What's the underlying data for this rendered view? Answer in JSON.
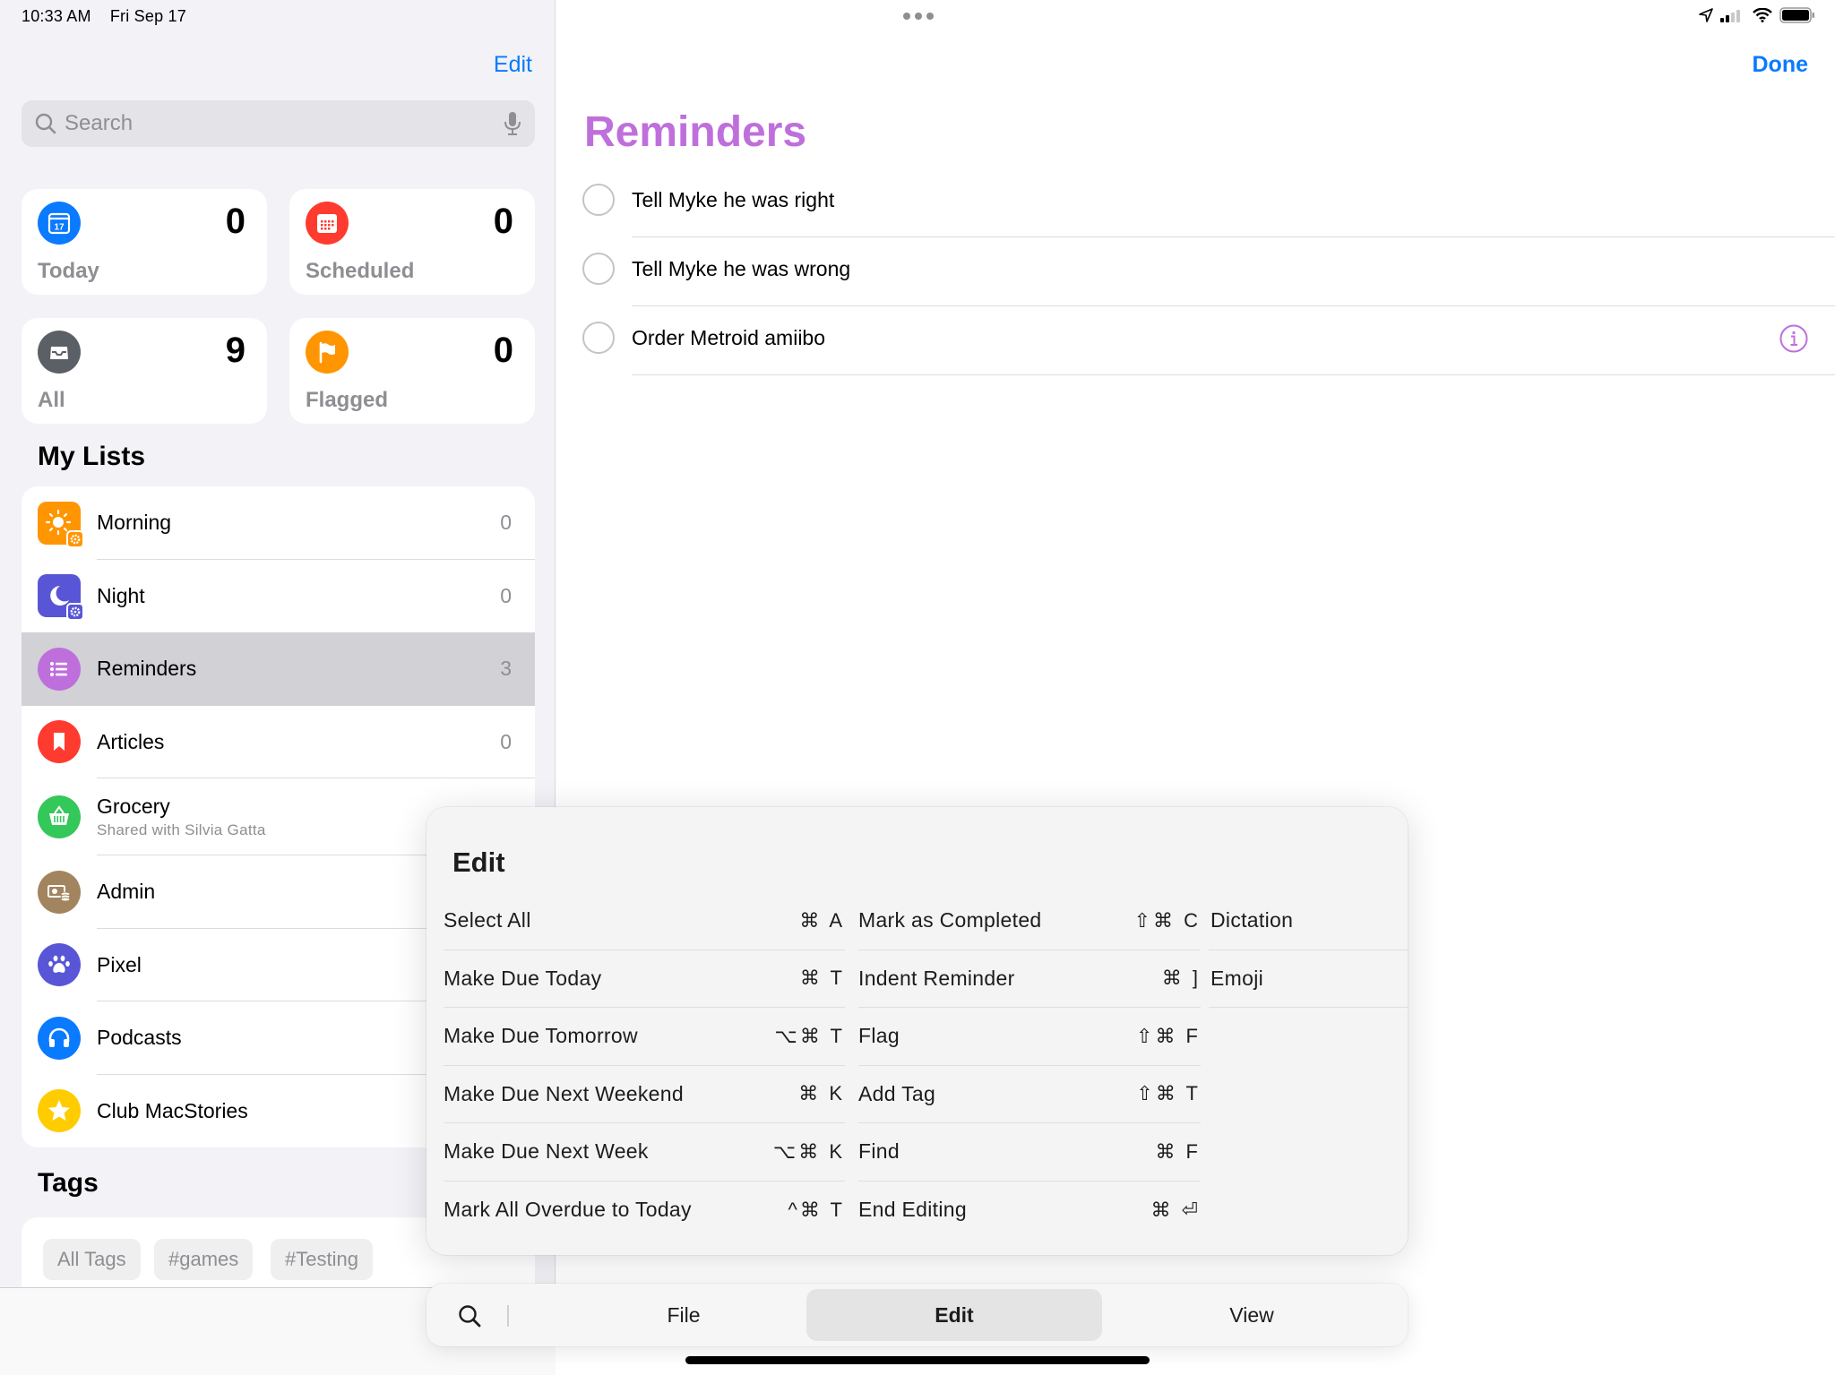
{
  "status_bar": {
    "time": "10:33 AM",
    "date": "Fri Sep 17",
    "icons": [
      "location-arrow-icon",
      "cellular-signal-icon",
      "wifi-icon",
      "battery-icon"
    ]
  },
  "sidebar": {
    "edit_label": "Edit",
    "search": {
      "placeholder": "Search",
      "value": ""
    },
    "smart_lists": [
      {
        "label": "Today",
        "count": "0",
        "icon": "calendar-17-icon",
        "color": "#0a7aff",
        "glyph": "17"
      },
      {
        "label": "Scheduled",
        "count": "0",
        "icon": "calendar-grid-icon",
        "color": "#ff3b30"
      },
      {
        "label": "All",
        "count": "9",
        "icon": "tray-icon",
        "color": "#5b5f66"
      },
      {
        "label": "Flagged",
        "count": "0",
        "icon": "flag-icon",
        "color": "#ff9500"
      }
    ],
    "my_lists_heading": "My Lists",
    "lists": [
      {
        "name": "Morning",
        "count": "0",
        "icon": "sun-icon",
        "color": "#ff9500",
        "shape": "square",
        "badge": "gear"
      },
      {
        "name": "Night",
        "count": "0",
        "icon": "moon-icon",
        "color": "#5856d6",
        "shape": "square",
        "badge": "gear"
      },
      {
        "name": "Reminders",
        "count": "3",
        "icon": "list-bullet-icon",
        "color": "#bf6fdc",
        "shape": "round",
        "selected": true
      },
      {
        "name": "Articles",
        "count": "0",
        "icon": "bookmark-icon",
        "color": "#ff3b30",
        "shape": "round"
      },
      {
        "name": "Grocery",
        "subtitle": "Shared with Silvia Gatta",
        "count": "",
        "icon": "basket-icon",
        "color": "#34c759",
        "shape": "round"
      },
      {
        "name": "Admin",
        "count": "",
        "icon": "money-icon",
        "color": "#a2845e",
        "shape": "round"
      },
      {
        "name": "Pixel",
        "count": "",
        "icon": "paw-icon",
        "color": "#5856d6",
        "shape": "round"
      },
      {
        "name": "Podcasts",
        "count": "",
        "icon": "headphones-icon",
        "color": "#0a7aff",
        "shape": "round"
      },
      {
        "name": "Club MacStories",
        "count": "",
        "icon": "star-icon",
        "color": "#ffcc00",
        "shape": "round"
      }
    ],
    "tags_heading": "Tags",
    "tags": [
      "All Tags",
      "#games",
      "#Testing"
    ]
  },
  "main": {
    "done_label": "Done",
    "title": "Reminders",
    "title_color": "#bf6fdc",
    "reminders": [
      {
        "text": "Tell Myke he was right",
        "completed": false
      },
      {
        "text": "Tell Myke he was wrong",
        "completed": false
      },
      {
        "text": "Order Metroid amiibo",
        "completed": false,
        "show_info": true
      }
    ]
  },
  "edit_menu": {
    "title": "Edit",
    "columns": [
      [
        {
          "label": "Select All",
          "shortcut": "⌘ A"
        },
        {
          "label": "Make Due Today",
          "shortcut": "⌘ T"
        },
        {
          "label": "Make Due Tomorrow",
          "shortcut": "⌥⌘ T"
        },
        {
          "label": "Make Due Next Weekend",
          "shortcut": "⌘ K"
        },
        {
          "label": "Make Due Next Week",
          "shortcut": "⌥⌘ K"
        },
        {
          "label": "Mark All Overdue to Today",
          "shortcut": "^⌘ T"
        }
      ],
      [
        {
          "label": "Mark as Completed",
          "shortcut": "⇧⌘ C"
        },
        {
          "label": "Indent Reminder",
          "shortcut": "⌘ ]"
        },
        {
          "label": "Flag",
          "shortcut": "⇧⌘ F"
        },
        {
          "label": "Add Tag",
          "shortcut": "⇧⌘ T"
        },
        {
          "label": "Find",
          "shortcut": "⌘ F"
        },
        {
          "label": "End Editing",
          "shortcut": "⌘ ⏎"
        }
      ],
      [
        {
          "label": "Dictation",
          "shortcut": ""
        },
        {
          "label": "Emoji",
          "shortcut": ""
        }
      ]
    ]
  },
  "menu_bar": {
    "items": [
      "File",
      "Edit",
      "View"
    ],
    "active": "Edit"
  }
}
